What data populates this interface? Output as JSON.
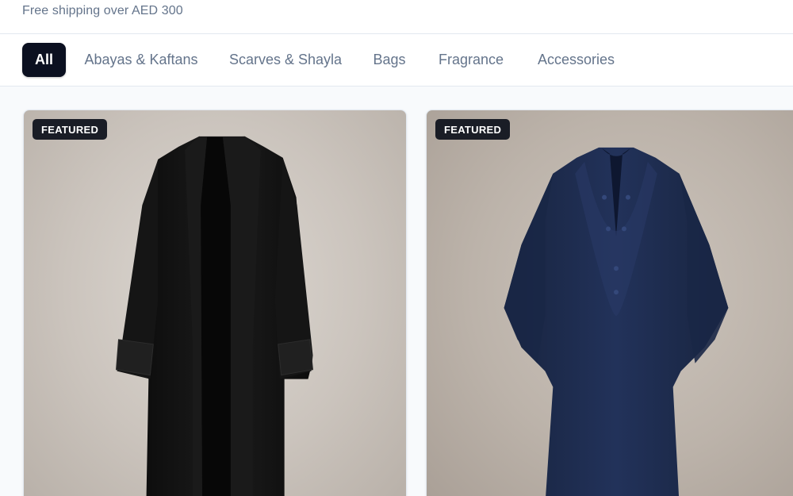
{
  "header": {
    "shipping_text": "Free shipping over AED 300"
  },
  "filters": {
    "items": [
      {
        "label": "All",
        "active": true
      },
      {
        "label": "Abayas & Kaftans",
        "active": false
      },
      {
        "label": "Scarves & Shayla",
        "active": false
      },
      {
        "label": "Bags",
        "active": false
      },
      {
        "label": "Fragrance",
        "active": false
      },
      {
        "label": "Accessories",
        "active": false
      }
    ]
  },
  "products": [
    {
      "badge": "FEATURED",
      "image_subject": "black open-front abaya",
      "color": "#141414"
    },
    {
      "badge": "FEATURED",
      "image_subject": "navy embroidered kaftan",
      "color": "#1c2a4a"
    }
  ],
  "colors": {
    "active_chip": "#0b1020",
    "muted_text": "#64748b",
    "badge_bg": "#1a1d26"
  }
}
